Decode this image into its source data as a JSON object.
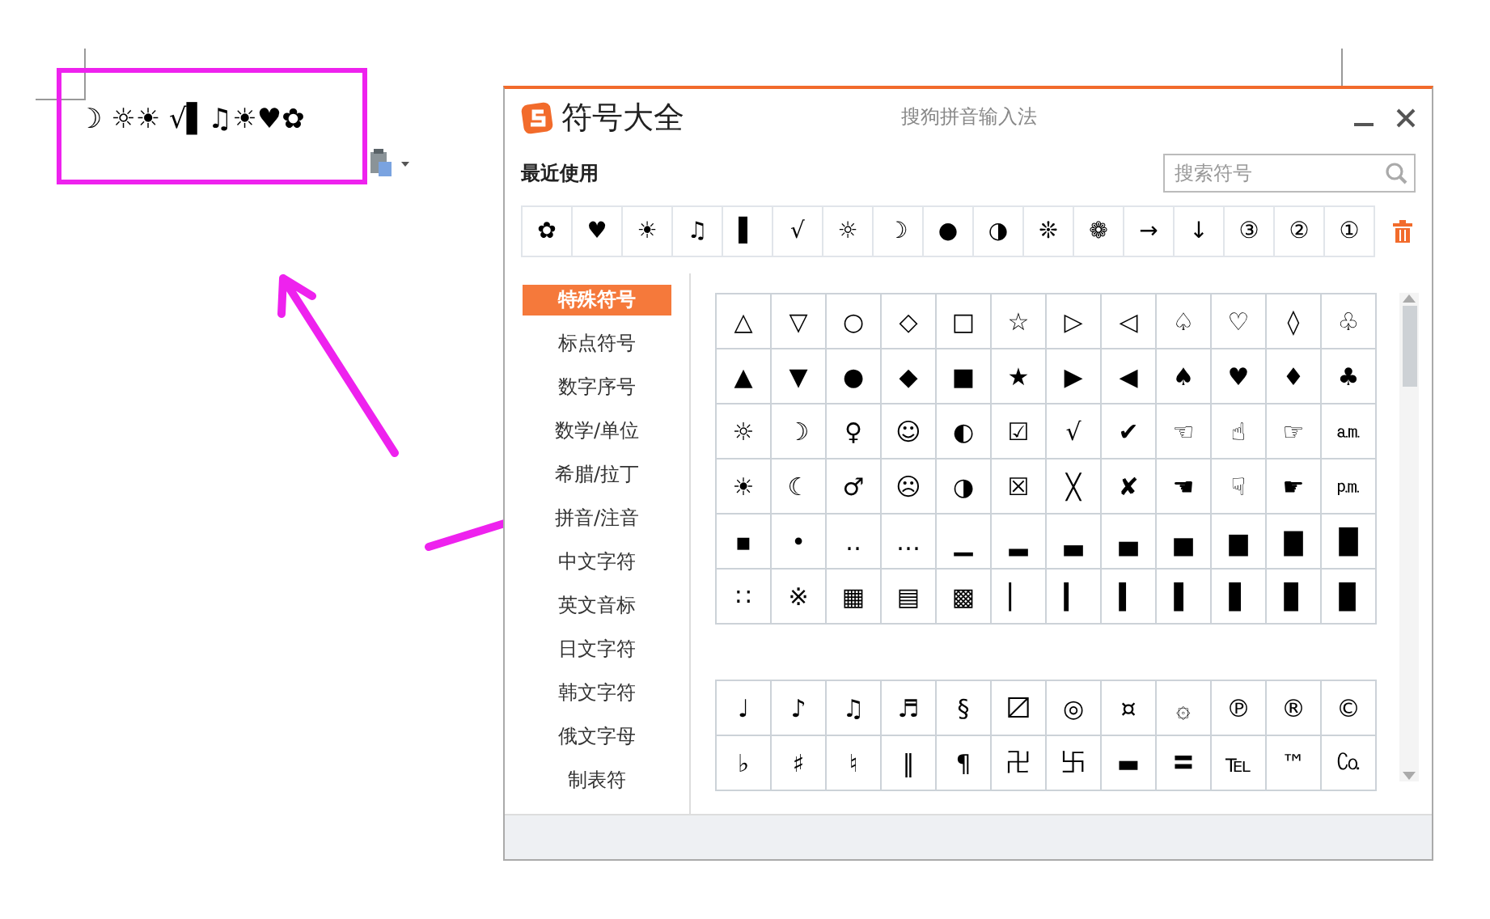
{
  "document": {
    "text": "☽ ☼☀ √▌♫☀♥✿"
  },
  "dialog": {
    "title": "符号大全",
    "app_name": "搜狗拼音输入法",
    "recent_label": "最近使用",
    "search": {
      "placeholder": "搜索符号"
    },
    "recent": [
      "✿",
      "♥",
      "☀",
      "♫",
      "▌",
      "√",
      "☼",
      "☽",
      "●",
      "◑",
      "❊",
      "❁",
      "→",
      "↓",
      "③",
      "②",
      "①"
    ],
    "categories": [
      {
        "label": "特殊符号",
        "selected": true
      },
      {
        "label": "标点符号",
        "selected": false
      },
      {
        "label": "数字序号",
        "selected": false
      },
      {
        "label": "数学/单位",
        "selected": false
      },
      {
        "label": "希腊/拉丁",
        "selected": false
      },
      {
        "label": "拼音/注音",
        "selected": false
      },
      {
        "label": "中文字符",
        "selected": false
      },
      {
        "label": "英文音标",
        "selected": false
      },
      {
        "label": "日文字符",
        "selected": false
      },
      {
        "label": "韩文字符",
        "selected": false
      },
      {
        "label": "俄文字母",
        "selected": false
      },
      {
        "label": "制表符",
        "selected": false
      }
    ],
    "groups": [
      [
        [
          "△",
          "▽",
          "○",
          "◇",
          "□",
          "☆",
          "▷",
          "◁",
          "♤",
          "♡",
          "◊",
          "♧"
        ],
        [
          "▲",
          "▼",
          "●",
          "◆",
          "■",
          "★",
          "▶",
          "◀",
          "♠",
          "♥",
          "♦",
          "♣"
        ],
        [
          "☼",
          "☽",
          "♀",
          "☺",
          "◐",
          "☑",
          "√",
          "✔",
          "☜",
          "☝",
          "☞",
          "㏂"
        ],
        [
          "☀",
          "☾",
          "♂",
          "☹",
          "◑",
          "☒",
          "╳",
          "✘",
          "☚",
          "☟",
          "☛",
          "㏘"
        ],
        [
          "▪",
          "•",
          "‥",
          "…",
          "▁",
          "▂",
          "▃",
          "▄",
          "▅",
          "▆",
          "▇",
          "█"
        ],
        [
          "∷",
          "※",
          "▦",
          "▤",
          "▩",
          "▏",
          "▎",
          "▍",
          "▌",
          "▋",
          "▊",
          "▉"
        ]
      ],
      [
        [
          "♩",
          "♪",
          "♫",
          "♬",
          "§",
          "〼",
          "◎",
          "¤",
          "۞",
          "℗",
          "®",
          "©"
        ],
        [
          "♭",
          "♯",
          "♮",
          "‖",
          "¶",
          "卍",
          "卐",
          "▬",
          "〓",
          "℡",
          "™",
          "㏇"
        ]
      ]
    ]
  }
}
